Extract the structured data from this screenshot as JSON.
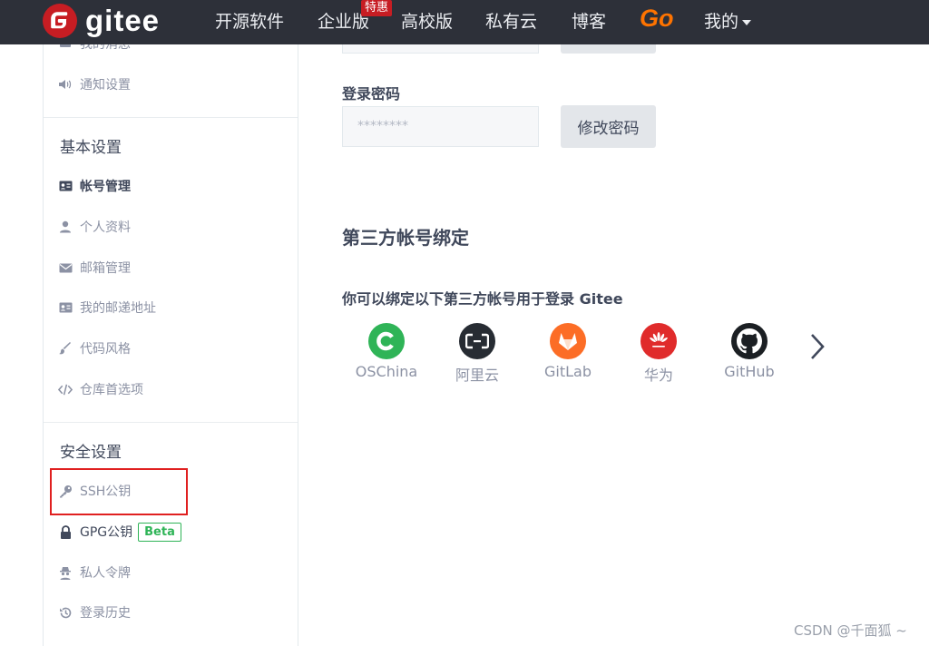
{
  "nav": {
    "brand": "gitee",
    "items": [
      "开源软件",
      "企业版",
      "高校版",
      "私有云",
      "博客"
    ],
    "badge": "特惠",
    "go": "Go",
    "mine": "我的"
  },
  "sidebar": {
    "top_cut": "我的消息",
    "notify": "通知设置",
    "basic_heading": "基本设置",
    "basic_items": [
      "帐号管理",
      "个人资料",
      "邮箱管理",
      "我的邮递地址",
      "代码风格",
      "仓库首选项"
    ],
    "security_heading": "安全设置",
    "security_items": [
      "SSH公钥",
      "GPG公钥",
      "私人令牌",
      "登录历史"
    ],
    "beta": "Beta"
  },
  "main": {
    "password_label": "登录密码",
    "password_value": "********",
    "change_password": "修改密码",
    "third_party_title": "第三方帐号绑定",
    "bind_desc": "你可以绑定以下第三方帐号用于登录 Gitee",
    "providers": [
      "OSChina",
      "阿里云",
      "GitLab",
      "华为",
      "GitHub"
    ]
  },
  "colors": {
    "nav_bg": "#2d3039",
    "brand_red": "#c71d23",
    "go_orange": "#fe7300",
    "oschina_green": "#2fb457",
    "aliyun_dark": "#272c33",
    "gitlab_orange": "#fc6d26",
    "huawei_red": "#e02b2b",
    "github_black": "#1b1f23",
    "highlight_red": "#e02020"
  },
  "watermark": "CSDN @千面狐 ~"
}
